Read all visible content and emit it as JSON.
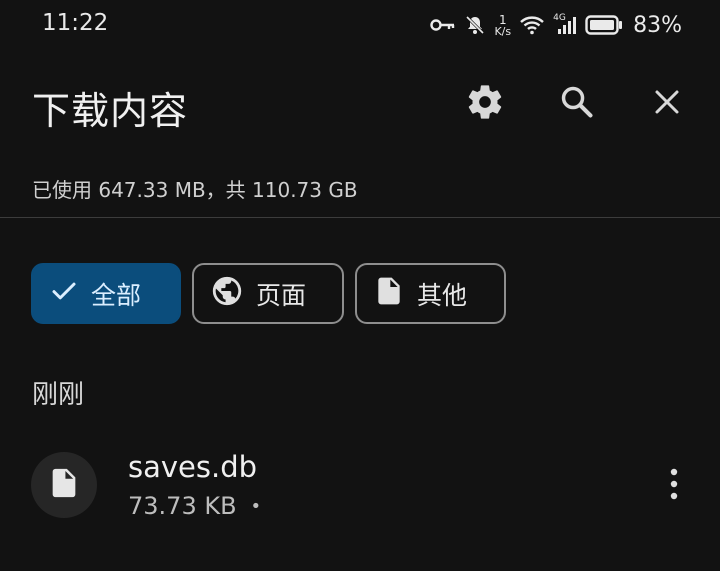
{
  "status_bar": {
    "time": "11:22",
    "speed_value": "1",
    "speed_unit": "K/s",
    "network_type": "4G",
    "battery_percent": "83%"
  },
  "app_bar": {
    "title": "下载内容"
  },
  "storage_summary": "已使用 647.33 MB，共 110.73 GB",
  "filters": {
    "all": "全部",
    "pages": "页面",
    "other": "其他"
  },
  "section_title": "刚刚",
  "downloads": [
    {
      "name": "saves.db",
      "size": "73.73 KB",
      "separator": "•"
    }
  ],
  "colors": {
    "background": "#121212",
    "chip_selected": "#0b4d7c",
    "text": "#e6e6e6"
  }
}
